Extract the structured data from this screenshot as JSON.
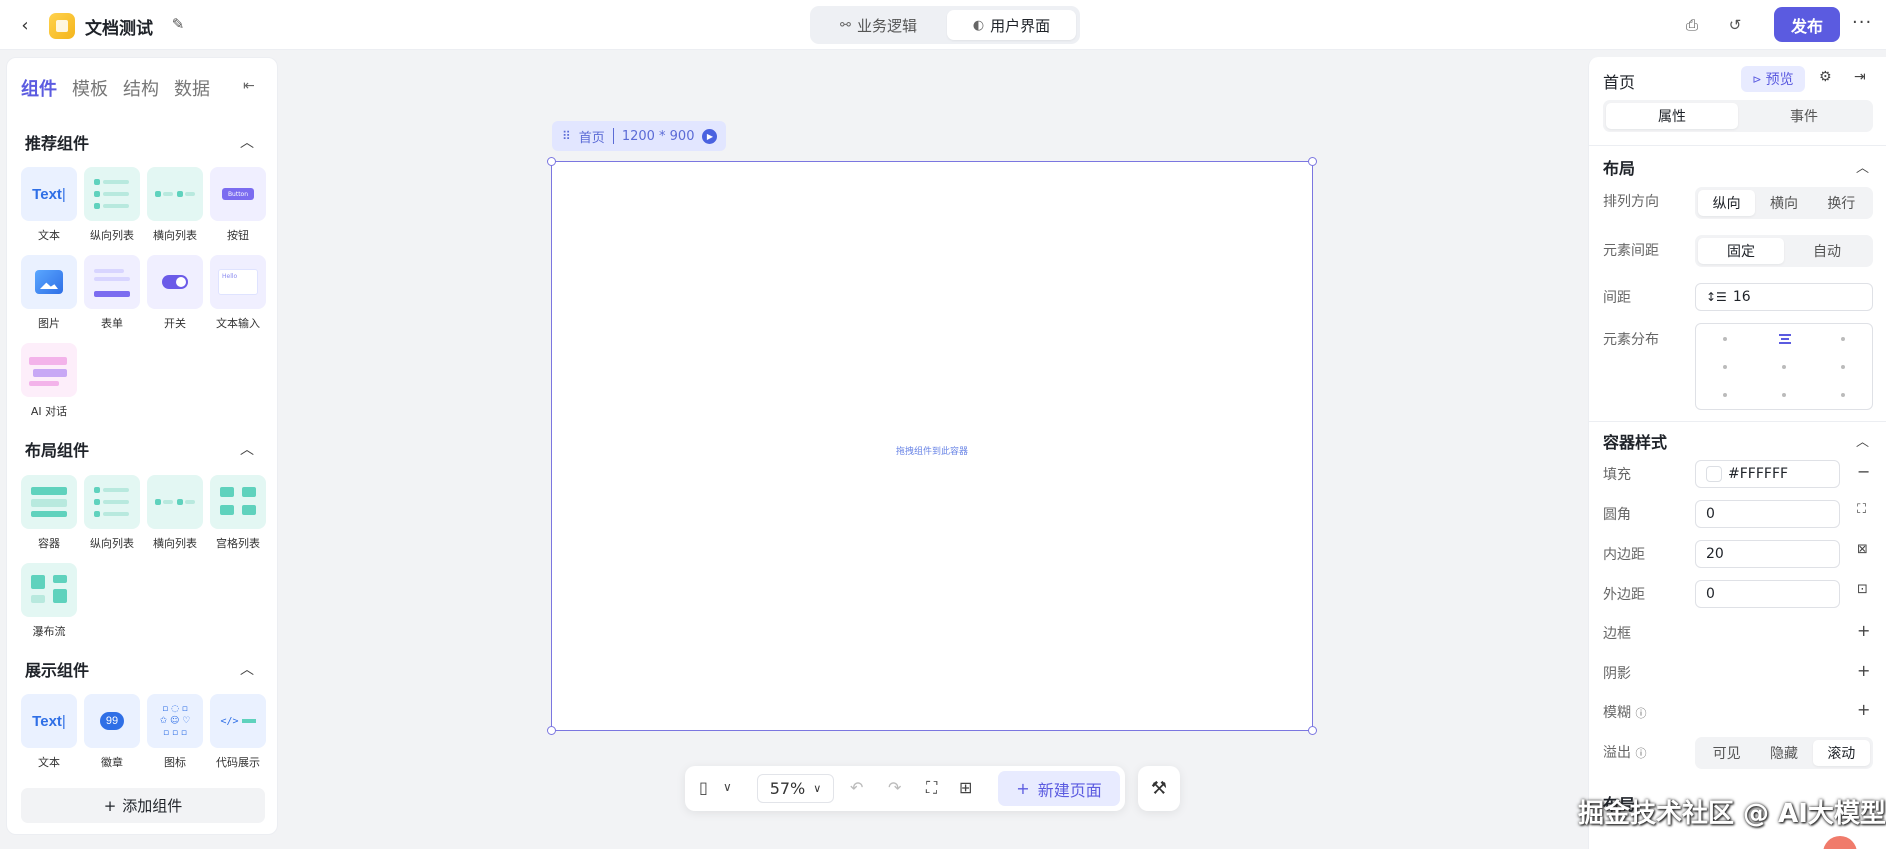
{
  "topbar": {
    "doc_title": "文档测试",
    "modes": [
      {
        "label": "业务逻辑",
        "active": false
      },
      {
        "label": "用户界面",
        "active": true
      }
    ],
    "publish_label": "发布",
    "more_label": "···"
  },
  "left_panel": {
    "tabs": [
      "组件",
      "模板",
      "结构",
      "数据"
    ],
    "active_tab": "组件",
    "sections": {
      "recommended": {
        "title": "推荐组件",
        "items": [
          "文本",
          "纵向列表",
          "横向列表",
          "按钮",
          "图片",
          "表单",
          "开关",
          "文本输入",
          "AI 对话"
        ]
      },
      "layout": {
        "title": "布局组件",
        "items": [
          "容器",
          "纵向列表",
          "横向列表",
          "宫格列表",
          "瀑布流"
        ]
      },
      "display": {
        "title": "展示组件",
        "items": [
          "文本",
          "徽章",
          "图标",
          "代码展示"
        ]
      }
    },
    "thumb_text": "Text",
    "thumb_button": "Button",
    "thumb_input": "Hello",
    "thumb_badge": "99",
    "add_component": "添加组件"
  },
  "canvas": {
    "frame_name": "首页",
    "frame_size": "1200 * 900",
    "dropzone_hint": "拖拽组件到此容器"
  },
  "toolbar": {
    "zoom": "57%",
    "new_page": "新建页面"
  },
  "right_panel": {
    "title": "首页",
    "preview_label": "预览",
    "tabs": [
      {
        "label": "属性",
        "active": true
      },
      {
        "label": "事件",
        "active": false
      }
    ],
    "layout": {
      "title": "布局",
      "direction_label": "排列方向",
      "direction_options": [
        "纵向",
        "横向",
        "换行"
      ],
      "direction_selected": "纵向",
      "spacing_mode_label": "元素间距",
      "spacing_mode_options": [
        "固定",
        "自动"
      ],
      "spacing_mode_selected": "固定",
      "gap_label": "间距",
      "gap_value": "16",
      "distribution_label": "元素分布"
    },
    "container_style": {
      "title": "容器样式",
      "fill_label": "填充",
      "fill_value": "#FFFFFF",
      "radius_label": "圆角",
      "radius_value": "0",
      "padding_label": "内边距",
      "padding_value": "20",
      "margin_label": "外边距",
      "margin_value": "0",
      "border_label": "边框",
      "shadow_label": "阴影",
      "blur_label": "模糊",
      "overflow_label": "溢出",
      "overflow_options": [
        "可见",
        "隐藏",
        "滚动"
      ],
      "overflow_selected": "滚动"
    },
    "cut_off_label": "布局"
  },
  "watermark": "掘金技术社区 @ AI大模型",
  "colors": {
    "accent": "#5b5be0",
    "frame_border": "#7b76e0",
    "canvas_bg": "#f2f3f5"
  }
}
